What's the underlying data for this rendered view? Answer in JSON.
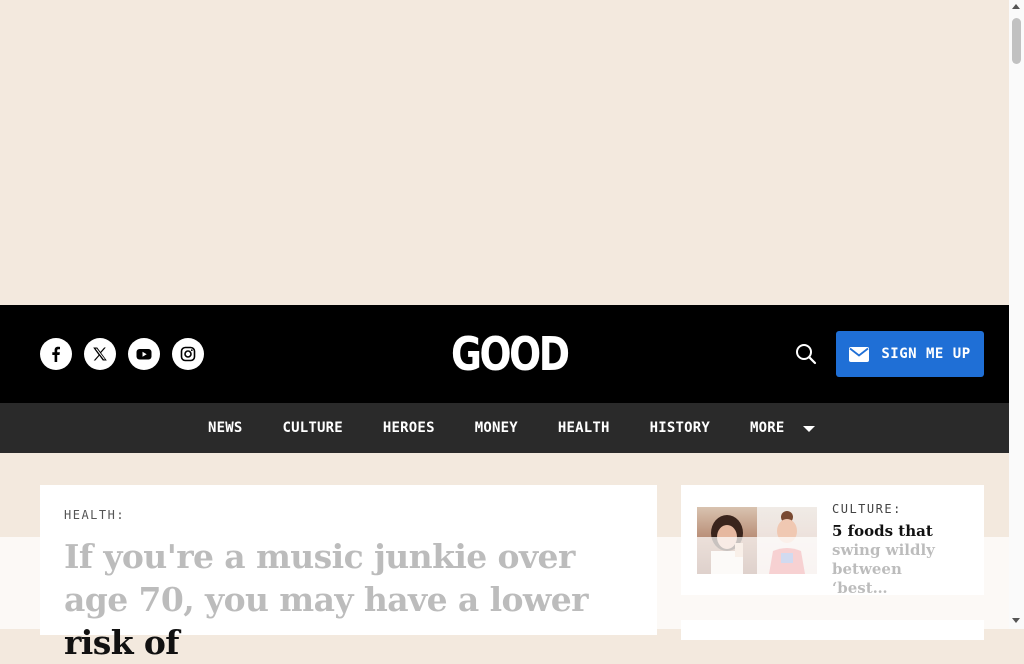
{
  "header": {
    "logo": "GOOD",
    "signup_label": "SIGN ME UP",
    "social": [
      "facebook-icon",
      "x-icon",
      "youtube-icon",
      "instagram-icon"
    ],
    "accent_color": "#1f6fd6",
    "background_color": "#000000"
  },
  "nav": {
    "items": [
      "NEWS",
      "CULTURE",
      "HEROES",
      "MONEY",
      "HEALTH",
      "HISTORY"
    ],
    "more_label": "MORE"
  },
  "article": {
    "category": "HEALTH:",
    "headline": "If you're a music junkie over age 70, you may have a lower risk of"
  },
  "sidebar": {
    "card": {
      "category": "CULTURE:",
      "title": "5 foods that swing wildly between ‘best…"
    }
  }
}
